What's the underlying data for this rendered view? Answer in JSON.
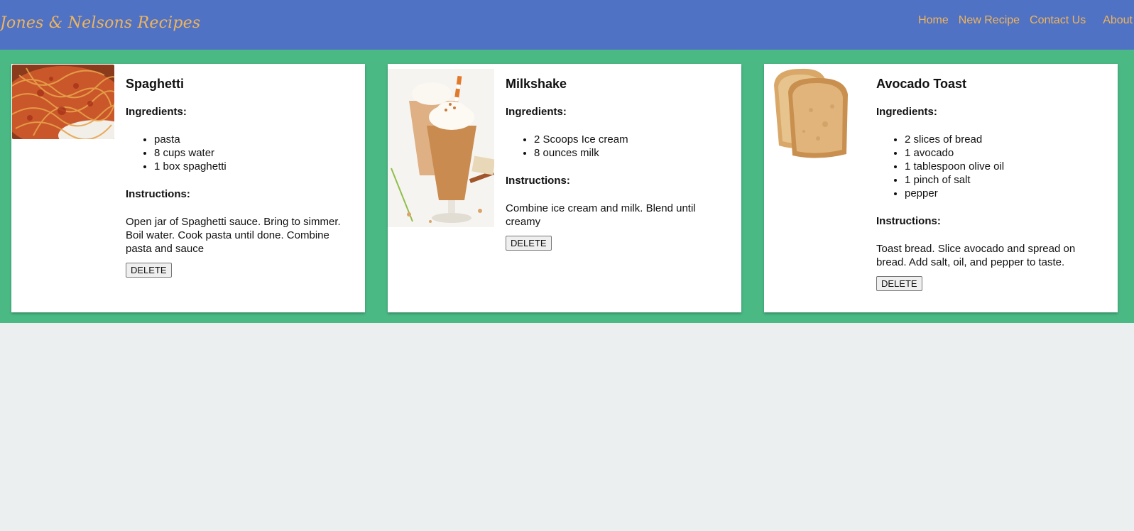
{
  "header": {
    "brand": "Jones & Nelsons Recipes",
    "nav": {
      "home": "Home",
      "new_recipe": "New Recipe",
      "contact": "Contact Us",
      "about": "About"
    }
  },
  "labels": {
    "ingredients": "Ingredients:",
    "instructions": "Instructions:",
    "delete": "DELETE"
  },
  "recipes": [
    {
      "title": "Spaghetti",
      "image": "spaghetti-photo",
      "ingredients": [
        "pasta",
        "8 cups water",
        "1 box spaghetti"
      ],
      "instructions": "Open jar of Spaghetti sauce. Bring to simmer. Boil water. Cook pasta until done. Combine pasta and sauce"
    },
    {
      "title": "Milkshake",
      "image": "milkshake-photo",
      "ingredients": [
        "2 Scoops Ice cream",
        "8 ounces milk"
      ],
      "instructions": "Combine ice cream and milk. Blend until creamy"
    },
    {
      "title": "Avocado Toast",
      "image": "toast-photo",
      "ingredients": [
        "2 slices of bread",
        "1 avocado",
        "1 tablespoon olive oil",
        "1 pinch of salt",
        "pepper"
      ],
      "instructions": "Toast bread. Slice avocado and spread on bread. Add salt, oil, and pepper to taste."
    }
  ],
  "colors": {
    "navbar": "#5072c4",
    "brand_text": "#f0b45a",
    "band": "#4ab984",
    "page_background": "#ebeff0",
    "card": "#ffffff"
  }
}
